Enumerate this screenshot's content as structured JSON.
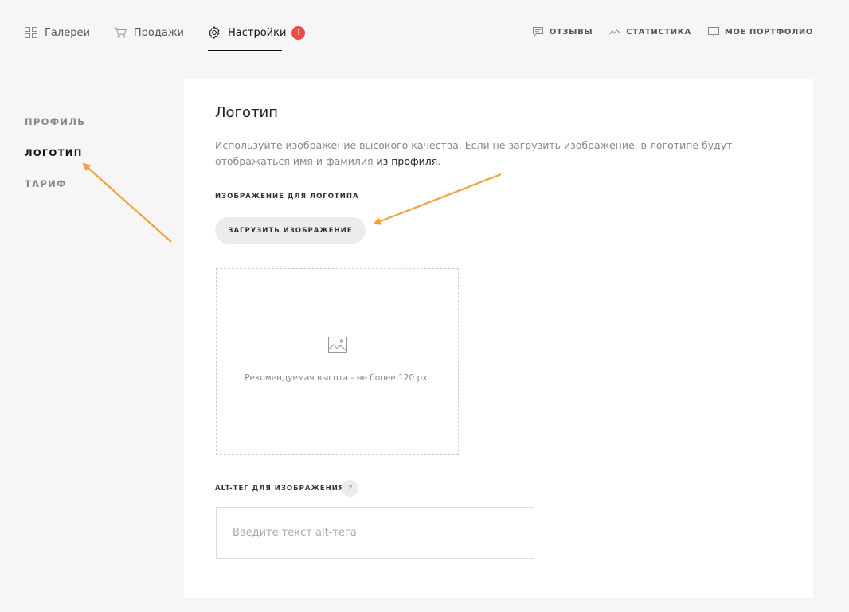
{
  "nav": {
    "left": [
      {
        "label": "Галереи",
        "icon": "grid-icon"
      },
      {
        "label": "Продажи",
        "icon": "cart-icon"
      },
      {
        "label": "Настройки",
        "icon": "gear-icon",
        "badge": "!"
      }
    ],
    "right": [
      {
        "label": "ОТЗЫВЫ",
        "icon": "comment-icon"
      },
      {
        "label": "СТАТИСТИКА",
        "icon": "chart-line-icon"
      },
      {
        "label": "МОЕ ПОРТФОЛИО",
        "icon": "monitor-icon"
      }
    ]
  },
  "sidebar": {
    "items": [
      {
        "label": "ПРОФИЛЬ"
      },
      {
        "label": "ЛОГОТИП"
      },
      {
        "label": "ТАРИФ"
      }
    ]
  },
  "content": {
    "title": "Логотип",
    "description": "Используйте изображение высокого качества. Если не загрузить изображение, в логотипе будут отображаться имя и фамилия ",
    "description_link": "из профиля",
    "description_end": ".",
    "image_label": "ИЗОБРАЖЕНИЕ ДЛЯ ЛОГОТИПА",
    "upload_button": "ЗАГРУЗИТЬ ИЗОБРАЖЕНИЕ",
    "dropzone_hint": "Рекомендуемая высота - не более 120 px.",
    "alt_label": "ALT-ТЕГ ДЛЯ ИЗОБРАЖЕНИЯ",
    "help": "?",
    "alt_value": "",
    "alt_placeholder": "Введите текст alt-тега"
  },
  "colors": {
    "accent_arrow": "#f0a33a",
    "badge": "#ef4b4b",
    "background": "#f6f6f6"
  }
}
